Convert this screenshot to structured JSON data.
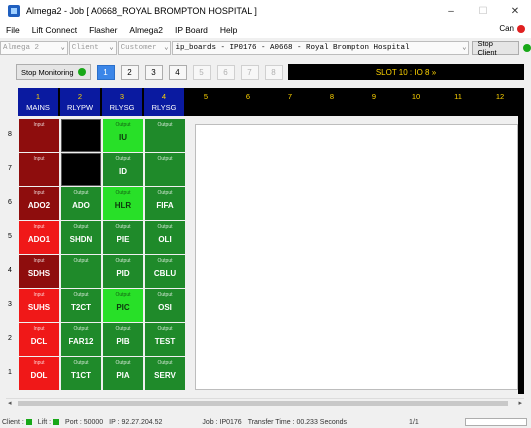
{
  "window": {
    "title": "Almega2 - Job [ A0668_ROYAL BROMPTON HOSPITAL ]",
    "minimize_glyph": "–",
    "maximize_glyph": "☐",
    "close_glyph": "✕"
  },
  "menu": {
    "items": [
      "File",
      "Lift Connect",
      "Flasher",
      "Almega2",
      "IP Board",
      "Help"
    ],
    "can_label": "Can"
  },
  "selectors": {
    "almega": "Almega 2",
    "client": "Client",
    "customer": "Customer",
    "board": "ip_boards - IP0176 - A0668 - Royal Brompton Hospital",
    "stop_client": "Stop Client"
  },
  "toolbar": {
    "stop_monitoring": "Stop Monitoring",
    "pages": [
      "1",
      "2",
      "3",
      "4",
      "5",
      "6",
      "7",
      "8"
    ],
    "active_page": "1",
    "slot_banner": "SLOT 10 : IO 8 »"
  },
  "columns": [
    {
      "num": "1",
      "label": "MAINS"
    },
    {
      "num": "2",
      "label": "RLYPW"
    },
    {
      "num": "3",
      "label": "RLYSG"
    },
    {
      "num": "4",
      "label": "RLYSG"
    },
    {
      "num": "5",
      "label": ""
    },
    {
      "num": "6",
      "label": ""
    },
    {
      "num": "7",
      "label": ""
    },
    {
      "num": "8",
      "label": ""
    },
    {
      "num": "9",
      "label": ""
    },
    {
      "num": "10",
      "label": ""
    },
    {
      "num": "11",
      "label": ""
    },
    {
      "num": "12",
      "label": ""
    }
  ],
  "rows": [
    "8",
    "7",
    "6",
    "5",
    "4",
    "3",
    "2",
    "1"
  ],
  "grid": [
    [
      {
        "type": "Input",
        "name": "",
        "color": "darkred"
      },
      {
        "type": "",
        "name": "",
        "color": "black"
      },
      {
        "type": "Output",
        "name": "IU",
        "color": "bright"
      },
      {
        "type": "Output",
        "name": "",
        "color": "green"
      }
    ],
    [
      {
        "type": "Input",
        "name": "",
        "color": "darkred"
      },
      {
        "type": "",
        "name": "",
        "color": "black"
      },
      {
        "type": "Output",
        "name": "ID",
        "color": "green"
      },
      {
        "type": "Output",
        "name": "",
        "color": "green"
      }
    ],
    [
      {
        "type": "Input",
        "name": "ADO2",
        "color": "darkred"
      },
      {
        "type": "Output",
        "name": "ADO",
        "color": "green"
      },
      {
        "type": "Output",
        "name": "HLR",
        "color": "bright"
      },
      {
        "type": "Output",
        "name": "FIFA",
        "color": "green"
      }
    ],
    [
      {
        "type": "Input",
        "name": "ADO1",
        "color": "red"
      },
      {
        "type": "Output",
        "name": "SHDN",
        "color": "green"
      },
      {
        "type": "Output",
        "name": "PIE",
        "color": "green"
      },
      {
        "type": "Output",
        "name": "OLI",
        "color": "green"
      }
    ],
    [
      {
        "type": "Input",
        "name": "SDHS",
        "color": "darkred"
      },
      {
        "type": "Output",
        "name": "",
        "color": "green"
      },
      {
        "type": "Output",
        "name": "PID",
        "color": "green"
      },
      {
        "type": "Output",
        "name": "CBLU",
        "color": "green"
      }
    ],
    [
      {
        "type": "Input",
        "name": "SUHS",
        "color": "red"
      },
      {
        "type": "Output",
        "name": "T2CT",
        "color": "green"
      },
      {
        "type": "Output",
        "name": "PIC",
        "color": "bright"
      },
      {
        "type": "Output",
        "name": "OSI",
        "color": "green"
      }
    ],
    [
      {
        "type": "Input",
        "name": "DCL",
        "color": "red"
      },
      {
        "type": "Output",
        "name": "FAR12",
        "color": "green"
      },
      {
        "type": "Output",
        "name": "PIB",
        "color": "green"
      },
      {
        "type": "Output",
        "name": "TEST",
        "color": "green"
      }
    ],
    [
      {
        "type": "Input",
        "name": "DOL",
        "color": "red"
      },
      {
        "type": "Output",
        "name": "T1CT",
        "color": "green"
      },
      {
        "type": "Output",
        "name": "PIA",
        "color": "green"
      },
      {
        "type": "Output",
        "name": "SERV",
        "color": "green"
      }
    ]
  ],
  "status": {
    "client": "Client :",
    "lift": "Lift :",
    "port": "Port : 50000",
    "ip": "IP : 92.27.204.52",
    "job": "Job : IP0176",
    "transfer": "Transfer Time : 00.233 Seconds",
    "page": "1/1"
  },
  "colors": {
    "darkred": "#8e0d0d",
    "red": "#f01818",
    "green": "#1f8a2a",
    "bright": "#28e028",
    "header_blue": "#0a1aa0",
    "active_page": "#3b86e8"
  }
}
